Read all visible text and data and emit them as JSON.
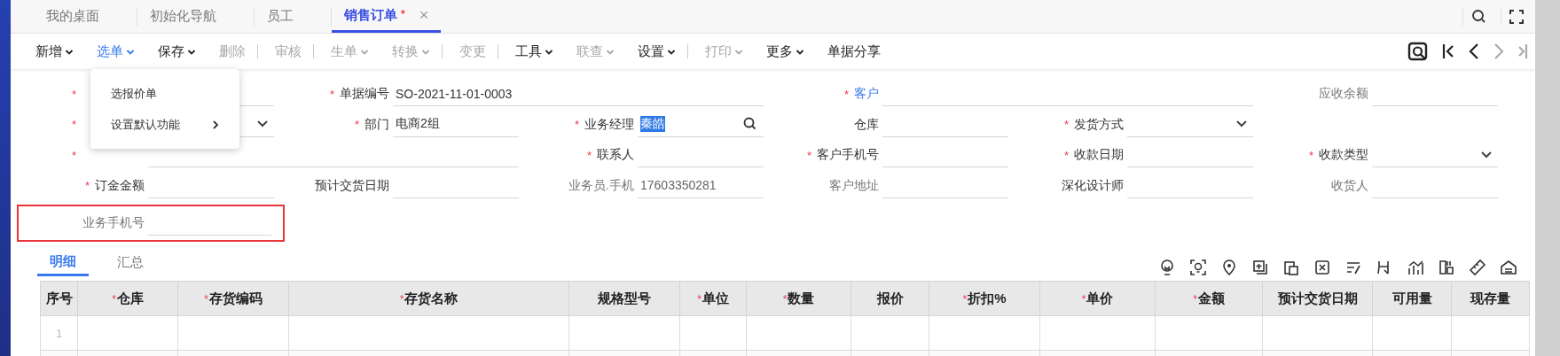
{
  "tabs": [
    {
      "label": "我的桌面",
      "selected": false
    },
    {
      "label": "初始化导航",
      "selected": false
    },
    {
      "label": "员工",
      "selected": false
    },
    {
      "label": "销售订单",
      "selected": true,
      "modified_mark": "*",
      "close": "×"
    }
  ],
  "toolbar": [
    {
      "label": "新增",
      "dropdown": true,
      "disabled": false,
      "selected": false
    },
    {
      "label": "选单",
      "dropdown": true,
      "disabled": false,
      "selected": true
    },
    {
      "label": "保存",
      "dropdown": true,
      "disabled": false,
      "selected": false
    },
    {
      "label": "删除",
      "dropdown": false,
      "disabled": true,
      "selected": false,
      "divider_after": true
    },
    {
      "label": "审核",
      "dropdown": false,
      "disabled": true,
      "selected": false,
      "divider_after": true
    },
    {
      "label": "生单",
      "dropdown": true,
      "disabled": true,
      "selected": false
    },
    {
      "label": "转换",
      "dropdown": true,
      "disabled": true,
      "selected": false,
      "divider_after": true
    },
    {
      "label": "变更",
      "dropdown": false,
      "disabled": true,
      "selected": false,
      "divider_after": true
    },
    {
      "label": "工具",
      "dropdown": true,
      "disabled": false,
      "selected": false
    },
    {
      "label": "联查",
      "dropdown": true,
      "disabled": true,
      "selected": false
    },
    {
      "label": "设置",
      "dropdown": true,
      "disabled": false,
      "selected": false,
      "divider_after": true
    },
    {
      "label": "打印",
      "dropdown": true,
      "disabled": true,
      "selected": false
    },
    {
      "label": "更多",
      "dropdown": true,
      "disabled": false,
      "selected": false
    },
    {
      "label": "单据分享",
      "dropdown": false,
      "disabled": false,
      "selected": false
    }
  ],
  "dropdown_menu": [
    {
      "label": "选报价单",
      "submenu": false
    },
    {
      "label": "设置默认功能",
      "submenu": true
    }
  ],
  "form_rows": [
    [
      {
        "mark": "*",
        "kind": "text"
      },
      {
        "label": "单据编号",
        "mark": "*",
        "kind": "text",
        "wide": true,
        "value": "SO-2021-11-01-0003"
      },
      {
        "label": "客户",
        "mark": "*",
        "kind": "text",
        "wide": true,
        "link": true
      },
      {
        "label": "应收余额",
        "kind": "text",
        "readonly": true
      }
    ],
    [
      {
        "mark": "*",
        "kind": "select"
      },
      {
        "label": "部门",
        "mark": "*",
        "kind": "text",
        "value": "电商2组"
      },
      {
        "label": "业务经理",
        "mark": "*",
        "kind": "search",
        "value": "秦皓",
        "value_selected": true
      },
      {
        "label": "仓库",
        "kind": "text"
      },
      {
        "label": "发货方式",
        "mark": "*",
        "kind": "select"
      }
    ],
    [
      {
        "mark": "*",
        "kind": "text",
        "wide": true
      },
      {
        "label": "联系人",
        "mark": "*",
        "kind": "text"
      },
      {
        "label": "客户手机号",
        "mark": "*",
        "kind": "text"
      },
      {
        "label": "收款日期",
        "mark": "*",
        "kind": "text"
      },
      {
        "label": "收款类型",
        "mark": "*",
        "kind": "select"
      }
    ],
    [
      {
        "label": "订金金额",
        "mark": "*",
        "kind": "text"
      },
      {
        "label": "预计交货日期",
        "kind": "text"
      },
      {
        "label": "业务员.手机",
        "kind": "text",
        "readonly": true,
        "value": "17603350281"
      },
      {
        "label": "客户地址",
        "kind": "text",
        "readonly": true
      },
      {
        "label": "深化设计师",
        "kind": "text"
      },
      {
        "label": "收货人",
        "kind": "text",
        "readonly": true
      }
    ],
    [
      {
        "label": "业务手机号",
        "kind": "text",
        "readonly": true,
        "outlined": true
      }
    ]
  ],
  "detail_tabs": [
    {
      "label": "明细",
      "selected": true
    },
    {
      "label": "汇总",
      "selected": false
    }
  ],
  "table": {
    "columns": [
      {
        "label": "序号"
      },
      {
        "label": "仓库",
        "mark": "*"
      },
      {
        "label": "存货编码",
        "mark": "*"
      },
      {
        "label": "存货名称",
        "mark": "*"
      },
      {
        "label": "规格型号"
      },
      {
        "label": "单位",
        "mark": "*"
      },
      {
        "label": "数量",
        "mark": "*"
      },
      {
        "label": "报价"
      },
      {
        "label": "折扣%",
        "mark": "*"
      },
      {
        "label": "单价",
        "mark": "*"
      },
      {
        "label": "金额",
        "mark": "*"
      },
      {
        "label": "预计交货日期"
      },
      {
        "label": "可用量"
      },
      {
        "label": "现存量"
      }
    ],
    "rows": [
      {
        "number": "1"
      }
    ]
  }
}
